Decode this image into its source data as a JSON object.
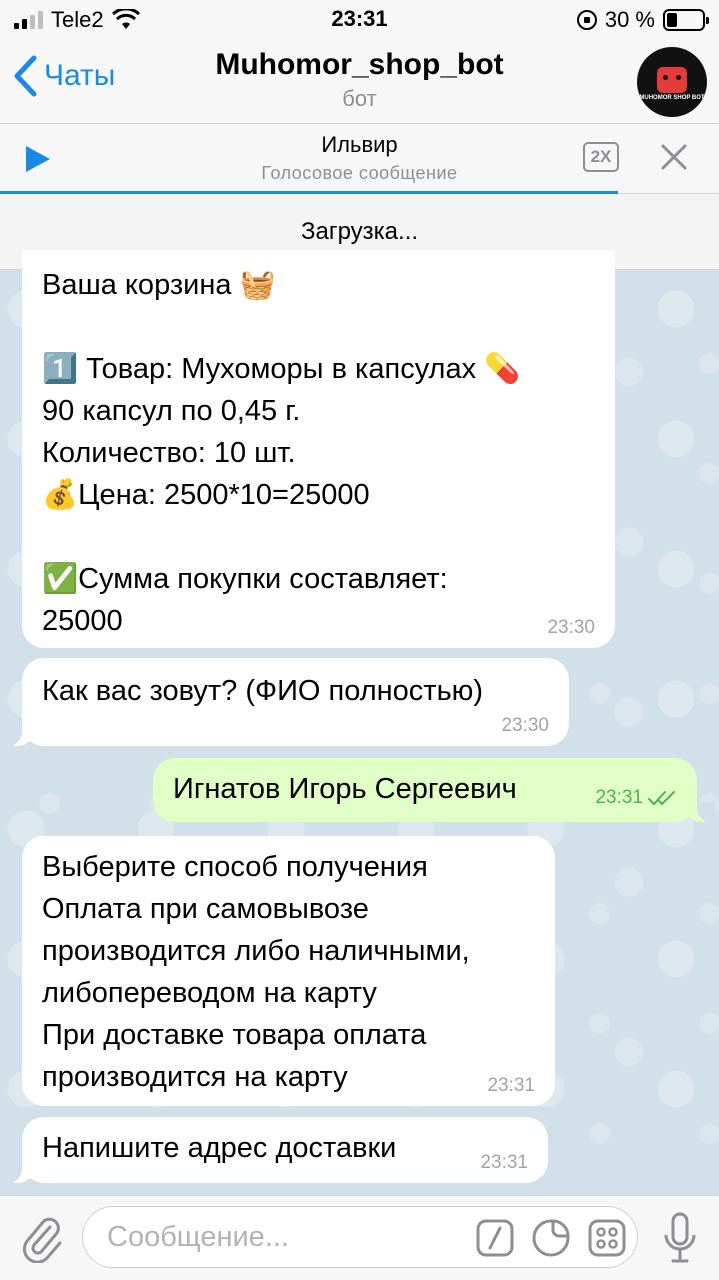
{
  "status_bar": {
    "carrier": "Tele2",
    "time": "23:31",
    "battery_text": "30 %",
    "battery_level": 0.3
  },
  "nav": {
    "back_label": "Чаты",
    "title": "Muhomor_shop_bot",
    "subtitle": "бот",
    "avatar_text": "MUHOMOR SHOP BOT"
  },
  "player": {
    "title": "Ильвир",
    "subtitle": "Голосовое сообщение",
    "speed_label": "2X",
    "progress": 0.86
  },
  "loading_text": "Загрузка...",
  "messages": [
    {
      "direction": "in",
      "lines": [
        "Ваша корзина 🧺",
        "",
        "1️⃣ Товар: Мухоморы в капсулах 💊",
        "90 капсул по 0,45 г.",
        "Количество: 10 шт.",
        "💰Цена: 2500*10=25000",
        "",
        "✅Сумма покупки составляет:",
        "25000"
      ],
      "time": "23:30"
    },
    {
      "direction": "in",
      "lines": [
        "Как вас зовут? (ФИО полностью)"
      ],
      "time": "23:30"
    },
    {
      "direction": "out",
      "lines": [
        "Игнатов Игорь Сергеевич"
      ],
      "time": "23:31",
      "status": "read"
    },
    {
      "direction": "in",
      "lines": [
        "Выберите способ получения",
        "Оплата при самовывозе",
        "производится либо наличными,",
        "либопереводом на карту",
        "При доставке товара оплата",
        "производится на карту"
      ],
      "time": "23:31"
    },
    {
      "direction": "in",
      "lines": [
        "Напишите адрес доставки"
      ],
      "time": "23:31"
    }
  ],
  "input": {
    "placeholder": "Сообщение..."
  },
  "icons": {
    "back": "chevron-left-icon",
    "play": "play-icon",
    "close": "close-icon",
    "attach": "paperclip-icon",
    "command": "slash-command-icon",
    "sticker": "sticker-icon",
    "keyboard": "bot-keyboard-icon",
    "mic": "microphone-icon"
  },
  "colors": {
    "accent": "#1a8ae5",
    "outgoing_bubble": "#e1fec6",
    "incoming_bubble": "#ffffff",
    "read_check": "#51b050"
  }
}
